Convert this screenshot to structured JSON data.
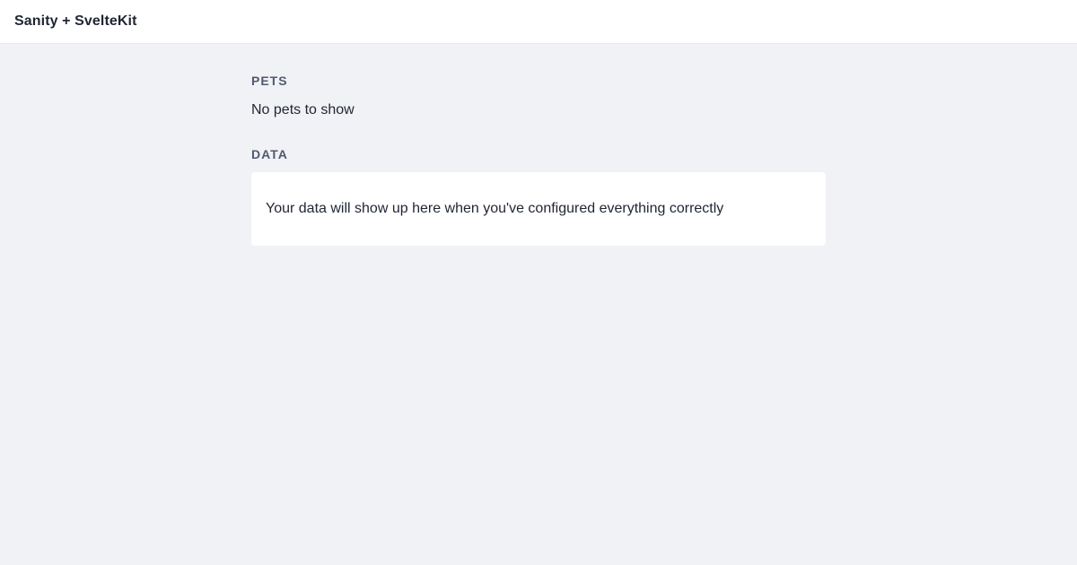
{
  "header": {
    "brand": "Sanity + SvelteKit"
  },
  "pets": {
    "heading": "PETS",
    "empty_message": "No pets to show"
  },
  "data": {
    "heading": "DATA",
    "placeholder_message": "Your data will show up here when you've configured everything correctly"
  },
  "colors": {
    "page_background": "#f1f2f6",
    "header_background": "#ffffff",
    "card_background": "#ffffff",
    "text": "#1f2533",
    "label_text": "#515a6e"
  }
}
